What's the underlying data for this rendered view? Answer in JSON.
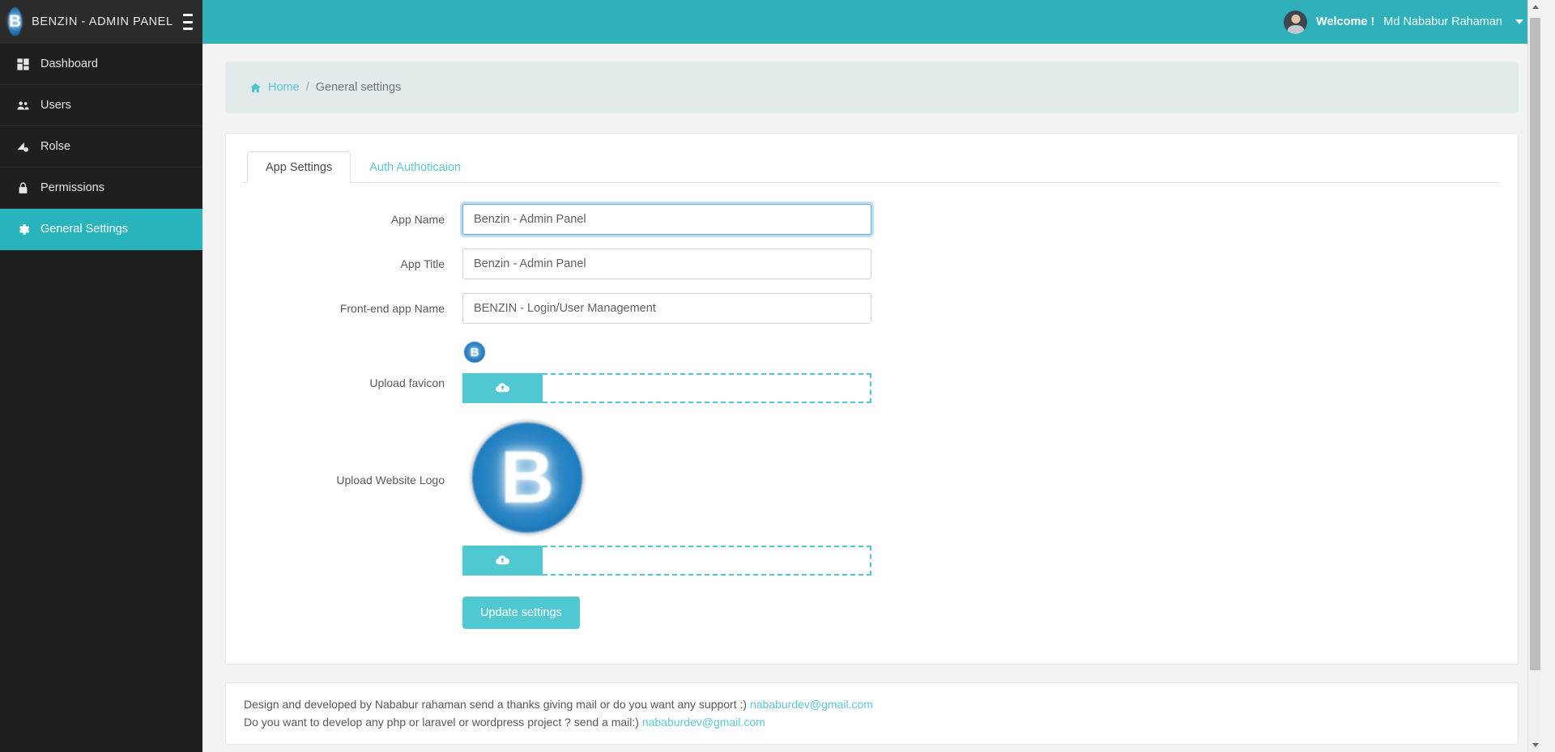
{
  "colors": {
    "accent_teal": "#2fb0bb",
    "accent_teal_light": "#4fc8d2",
    "sidebar_dark": "#1f1f1f",
    "brand_blue": "#2380c2",
    "focus_blue": "#66afe9"
  },
  "sidebar": {
    "brand_title": "BENZIN - ADMIN PANEL",
    "brand_logo_letter": "B",
    "items": [
      {
        "label": "Dashboard",
        "icon": "dashboard-icon",
        "active": false
      },
      {
        "label": "Users",
        "icon": "users-icon",
        "active": false
      },
      {
        "label": "Rolse",
        "icon": "rolse-icon",
        "active": false
      },
      {
        "label": "Permissions",
        "icon": "lock-icon",
        "active": false
      },
      {
        "label": "General Settings",
        "icon": "gear-icon",
        "active": true
      }
    ]
  },
  "topbar": {
    "welcome_label": "Welcome !",
    "user_name": "Md Nababur Rahaman",
    "avatar": "user-avatar",
    "caret": "chevron-down-icon"
  },
  "breadcrumb": {
    "home_icon": "home-icon",
    "home_label": "Home",
    "separator": "/",
    "current": "General settings"
  },
  "tabs": [
    {
      "label": "App Settings",
      "active": true
    },
    {
      "label": "Auth Authoticaion",
      "active": false
    }
  ],
  "form": {
    "fields": [
      {
        "label": "App Name",
        "value": "Benzin - Admin Panel",
        "placeholder": "App Name",
        "focused": true
      },
      {
        "label": "App Title",
        "value": "Benzin - Admin Panel",
        "placeholder": "App Title",
        "focused": false
      },
      {
        "label": "Front-end app Name",
        "value": "BENZIN - Login/User Management",
        "placeholder": "Front-end app Name",
        "focused": false
      }
    ],
    "favicon_upload": {
      "label": "Upload favicon",
      "preview_letter": "B",
      "button_icon": "cloud-upload-icon"
    },
    "logo_upload": {
      "label": "Upload Website Logo",
      "preview_letter": "B",
      "button_icon": "cloud-upload-icon"
    },
    "submit_label": "Update settings"
  },
  "footer": {
    "line1_text": "Design and developed by Nababur rahaman send a thanks giving mail or do you want any support :) ",
    "line1_email": "nababurdev@gmail.com",
    "line2_text": "Do you want to develop any php or laravel or wordpress project ? send a mail:) ",
    "line2_email": "nababurdev@gmail.com"
  }
}
